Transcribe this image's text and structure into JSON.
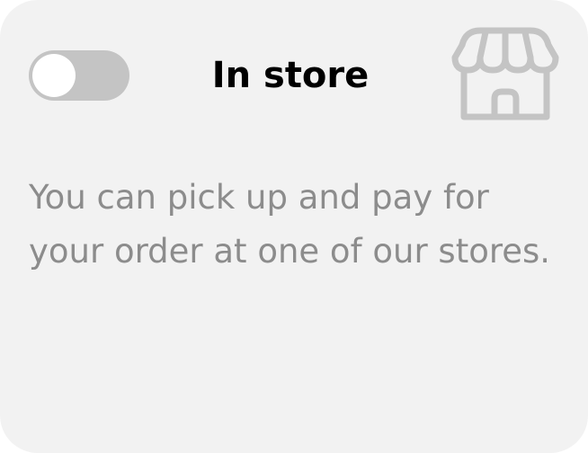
{
  "delivery_option": {
    "toggle_state": "off",
    "title": "In store",
    "icon": "store-icon",
    "description": "You can pick up and pay for your order at one of our stores."
  },
  "colors": {
    "card_background": "#f2f2f2",
    "toggle_track": "#c4c4c4",
    "toggle_knob": "#ffffff",
    "icon": "#c4c4c4",
    "title": "#000000",
    "description": "#8c8c8c"
  }
}
